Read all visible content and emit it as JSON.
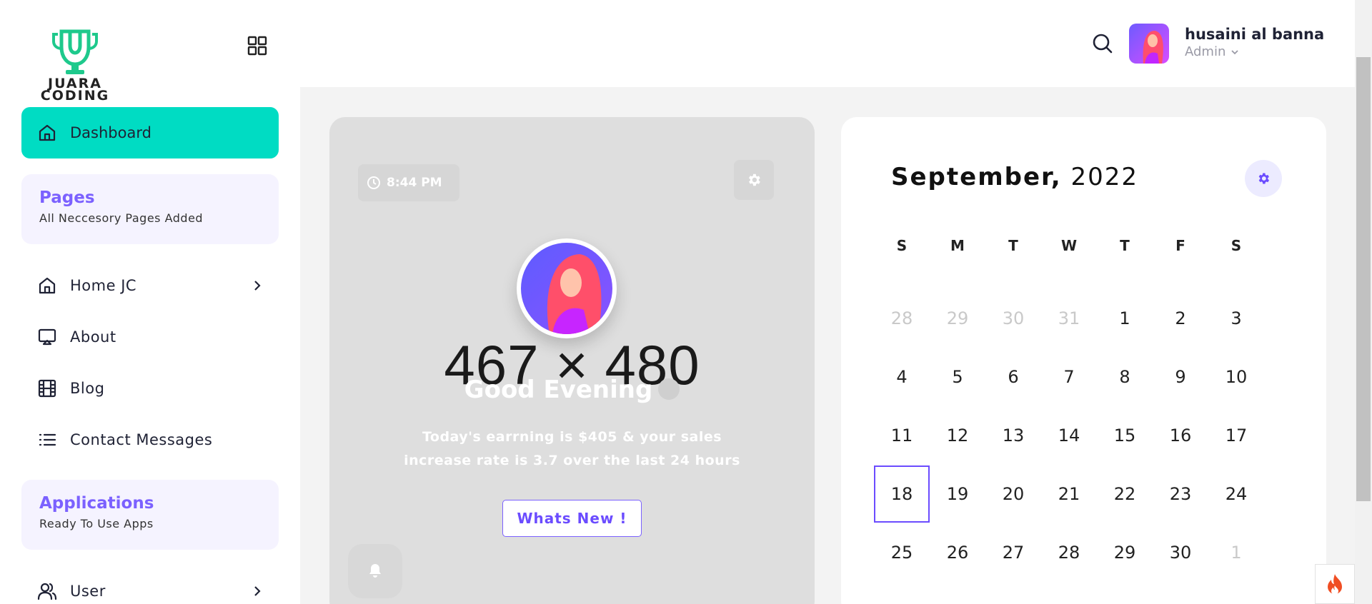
{
  "brand": {
    "logo_text": "JUARA\nCODING",
    "accent": "#00dcc3",
    "primary": "#7b61ff"
  },
  "sidebar": {
    "dashboard_label": "Dashboard",
    "pages_section": {
      "title": "Pages",
      "subtitle": "All Neccesory Pages Added"
    },
    "items": [
      {
        "label": "Home JC",
        "icon": "home-icon",
        "has_submenu": true
      },
      {
        "label": "About",
        "icon": "monitor-icon",
        "has_submenu": false
      },
      {
        "label": "Blog",
        "icon": "film-icon",
        "has_submenu": false
      },
      {
        "label": "Contact Messages",
        "icon": "list-icon",
        "has_submenu": false
      }
    ],
    "apps_section": {
      "title": "Applications",
      "subtitle": "Ready To Use Apps"
    },
    "user_item": {
      "label": "User",
      "icon": "users-icon",
      "has_submenu": true
    }
  },
  "header": {
    "user_name": "husaini al banna",
    "user_role": "Admin"
  },
  "welcome": {
    "time": "8:44 PM",
    "placeholder_size": "467 × 480",
    "greeting": "Good Evening",
    "earning_text": "Today's earrning is $405 & your sales increase rate is 3.7 over the last 24 hours",
    "button_label": "Whats New !"
  },
  "calendar": {
    "month": "September,",
    "year": "2022",
    "weekdays": [
      "S",
      "M",
      "T",
      "W",
      "T",
      "F",
      "S"
    ],
    "weeks": [
      [
        "28",
        "29",
        "30",
        "31",
        "1",
        "2",
        "3"
      ],
      [
        "4",
        "5",
        "6",
        "7",
        "8",
        "9",
        "10"
      ],
      [
        "11",
        "12",
        "13",
        "14",
        "15",
        "16",
        "17"
      ],
      [
        "18",
        "19",
        "20",
        "21",
        "22",
        "23",
        "24"
      ],
      [
        "25",
        "26",
        "27",
        "28",
        "29",
        "30",
        "1"
      ]
    ],
    "muted": [
      [
        0,
        0
      ],
      [
        0,
        1
      ],
      [
        0,
        2
      ],
      [
        0,
        3
      ],
      [
        4,
        6
      ]
    ],
    "today": [
      3,
      0
    ]
  }
}
